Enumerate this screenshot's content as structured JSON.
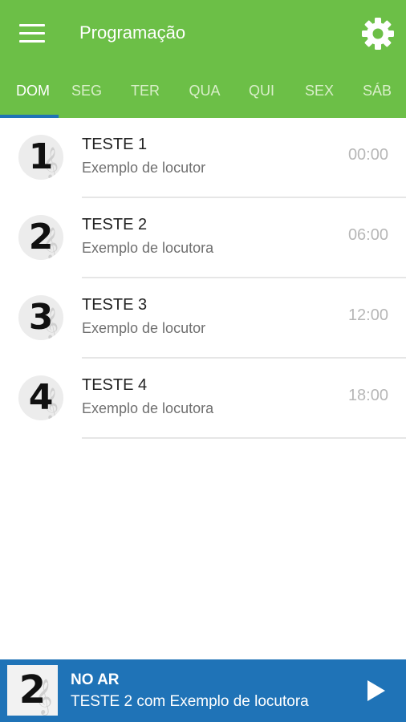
{
  "app_bar": {
    "title": "Programação",
    "menu_icon": "hamburger-menu-icon",
    "settings_icon": "gear-icon",
    "background_color": "#6cbf47"
  },
  "tabs": [
    {
      "label": "DOM",
      "active": true
    },
    {
      "label": "SEG",
      "active": false
    },
    {
      "label": "TER",
      "active": false
    },
    {
      "label": "QUA",
      "active": false
    },
    {
      "label": "QUI",
      "active": false
    },
    {
      "label": "SEX",
      "active": false
    },
    {
      "label": "SÁB",
      "active": false
    }
  ],
  "schedule": [
    {
      "badge": "1",
      "title": "TESTE 1",
      "host": "Exemplo de locutor",
      "time": "00:00"
    },
    {
      "badge": "2",
      "title": "TESTE 2",
      "host": "Exemplo de locutora",
      "time": "06:00"
    },
    {
      "badge": "3",
      "title": "TESTE 3",
      "host": "Exemplo de locutor",
      "time": "12:00"
    },
    {
      "badge": "4",
      "title": "TESTE 4",
      "host": "Exemplo de locutora",
      "time": "18:00"
    }
  ],
  "player": {
    "badge": "2",
    "label": "NO AR",
    "track": "TESTE 2 com Exemplo de locutora",
    "play_icon": "play-icon",
    "background_color": "#1f73b7"
  }
}
